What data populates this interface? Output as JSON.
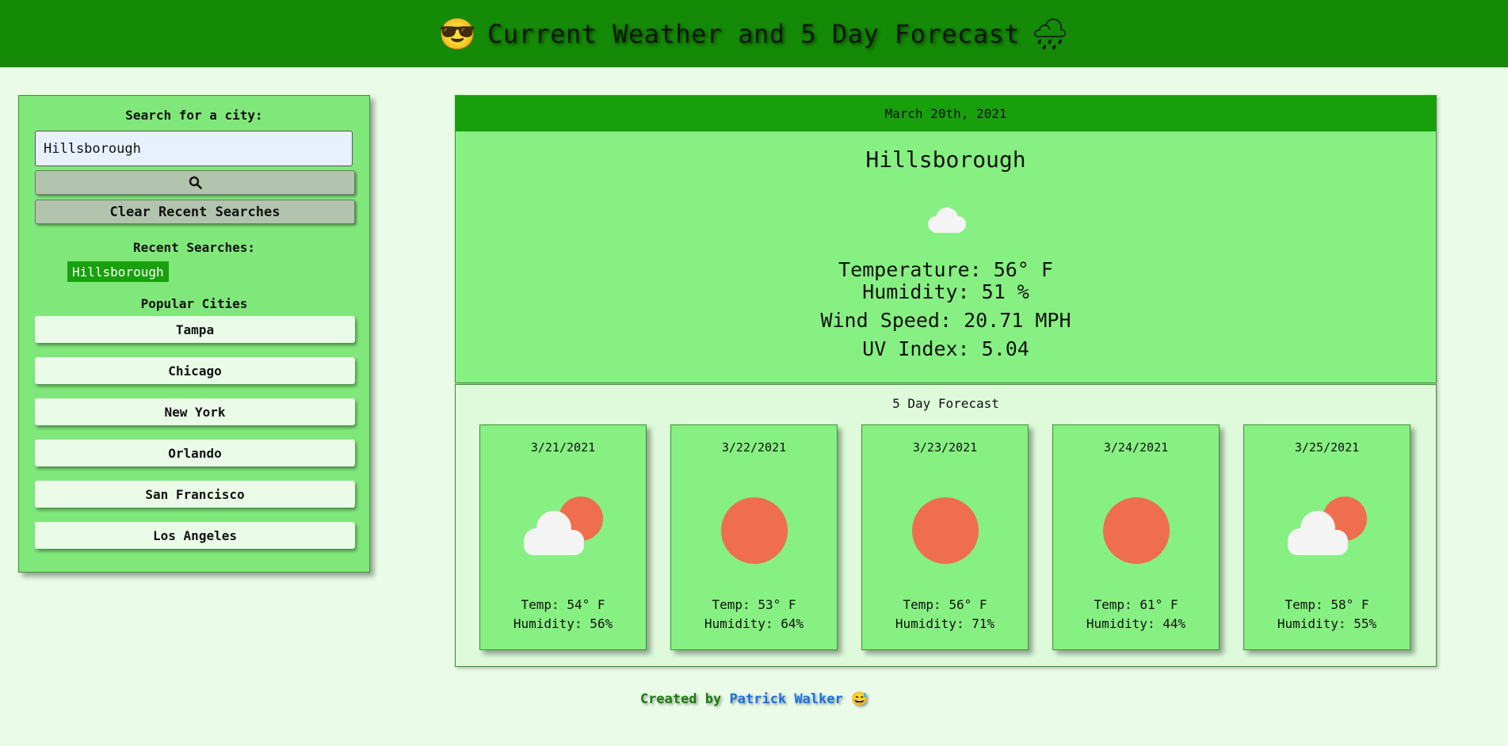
{
  "header": {
    "title": "Current Weather and 5 Day Forecast",
    "left_emoji": "😎",
    "right_emoji": "🌧"
  },
  "sidebar": {
    "search_label": "Search for a city:",
    "search_value": "Hillsborough",
    "clear_label": "Clear Recent Searches",
    "recent_label": "Recent Searches:",
    "recent": [
      "Hillsborough"
    ],
    "popular_label": "Popular Cities",
    "cities": [
      "Tampa",
      "Chicago",
      "New York",
      "Orlando",
      "San Francisco",
      "Los Angeles"
    ]
  },
  "current": {
    "date": "March 20th, 2021",
    "city": "Hillsborough",
    "icon": "cloud-icon",
    "temperature": "Temperature: 56° F",
    "humidity": "Humidity: 51 %",
    "wind": "Wind Speed: 20.71 MPH",
    "uv": "UV Index: 5.04"
  },
  "forecast": {
    "title": "5 Day Forecast",
    "days": [
      {
        "date": "3/21/2021",
        "icon": "partly-cloudy-icon",
        "temp": "Temp: 54° F",
        "humidity": "Humidity: 56%"
      },
      {
        "date": "3/22/2021",
        "icon": "sun-icon",
        "temp": "Temp: 53° F",
        "humidity": "Humidity: 64%"
      },
      {
        "date": "3/23/2021",
        "icon": "sun-icon",
        "temp": "Temp: 56° F",
        "humidity": "Humidity: 71%"
      },
      {
        "date": "3/24/2021",
        "icon": "sun-icon",
        "temp": "Temp: 61° F",
        "humidity": "Humidity: 44%"
      },
      {
        "date": "3/25/2021",
        "icon": "partly-cloudy-icon",
        "temp": "Temp: 58° F",
        "humidity": "Humidity: 55%"
      }
    ]
  },
  "footer": {
    "prefix": "Created by",
    "author": "Patrick Walker",
    "emoji": "😅"
  },
  "colors": {
    "header": "#148a06",
    "panel": "#87f082",
    "chip": "#18a00d",
    "sun": "#ee6e4e",
    "link": "#1c6fe0"
  }
}
